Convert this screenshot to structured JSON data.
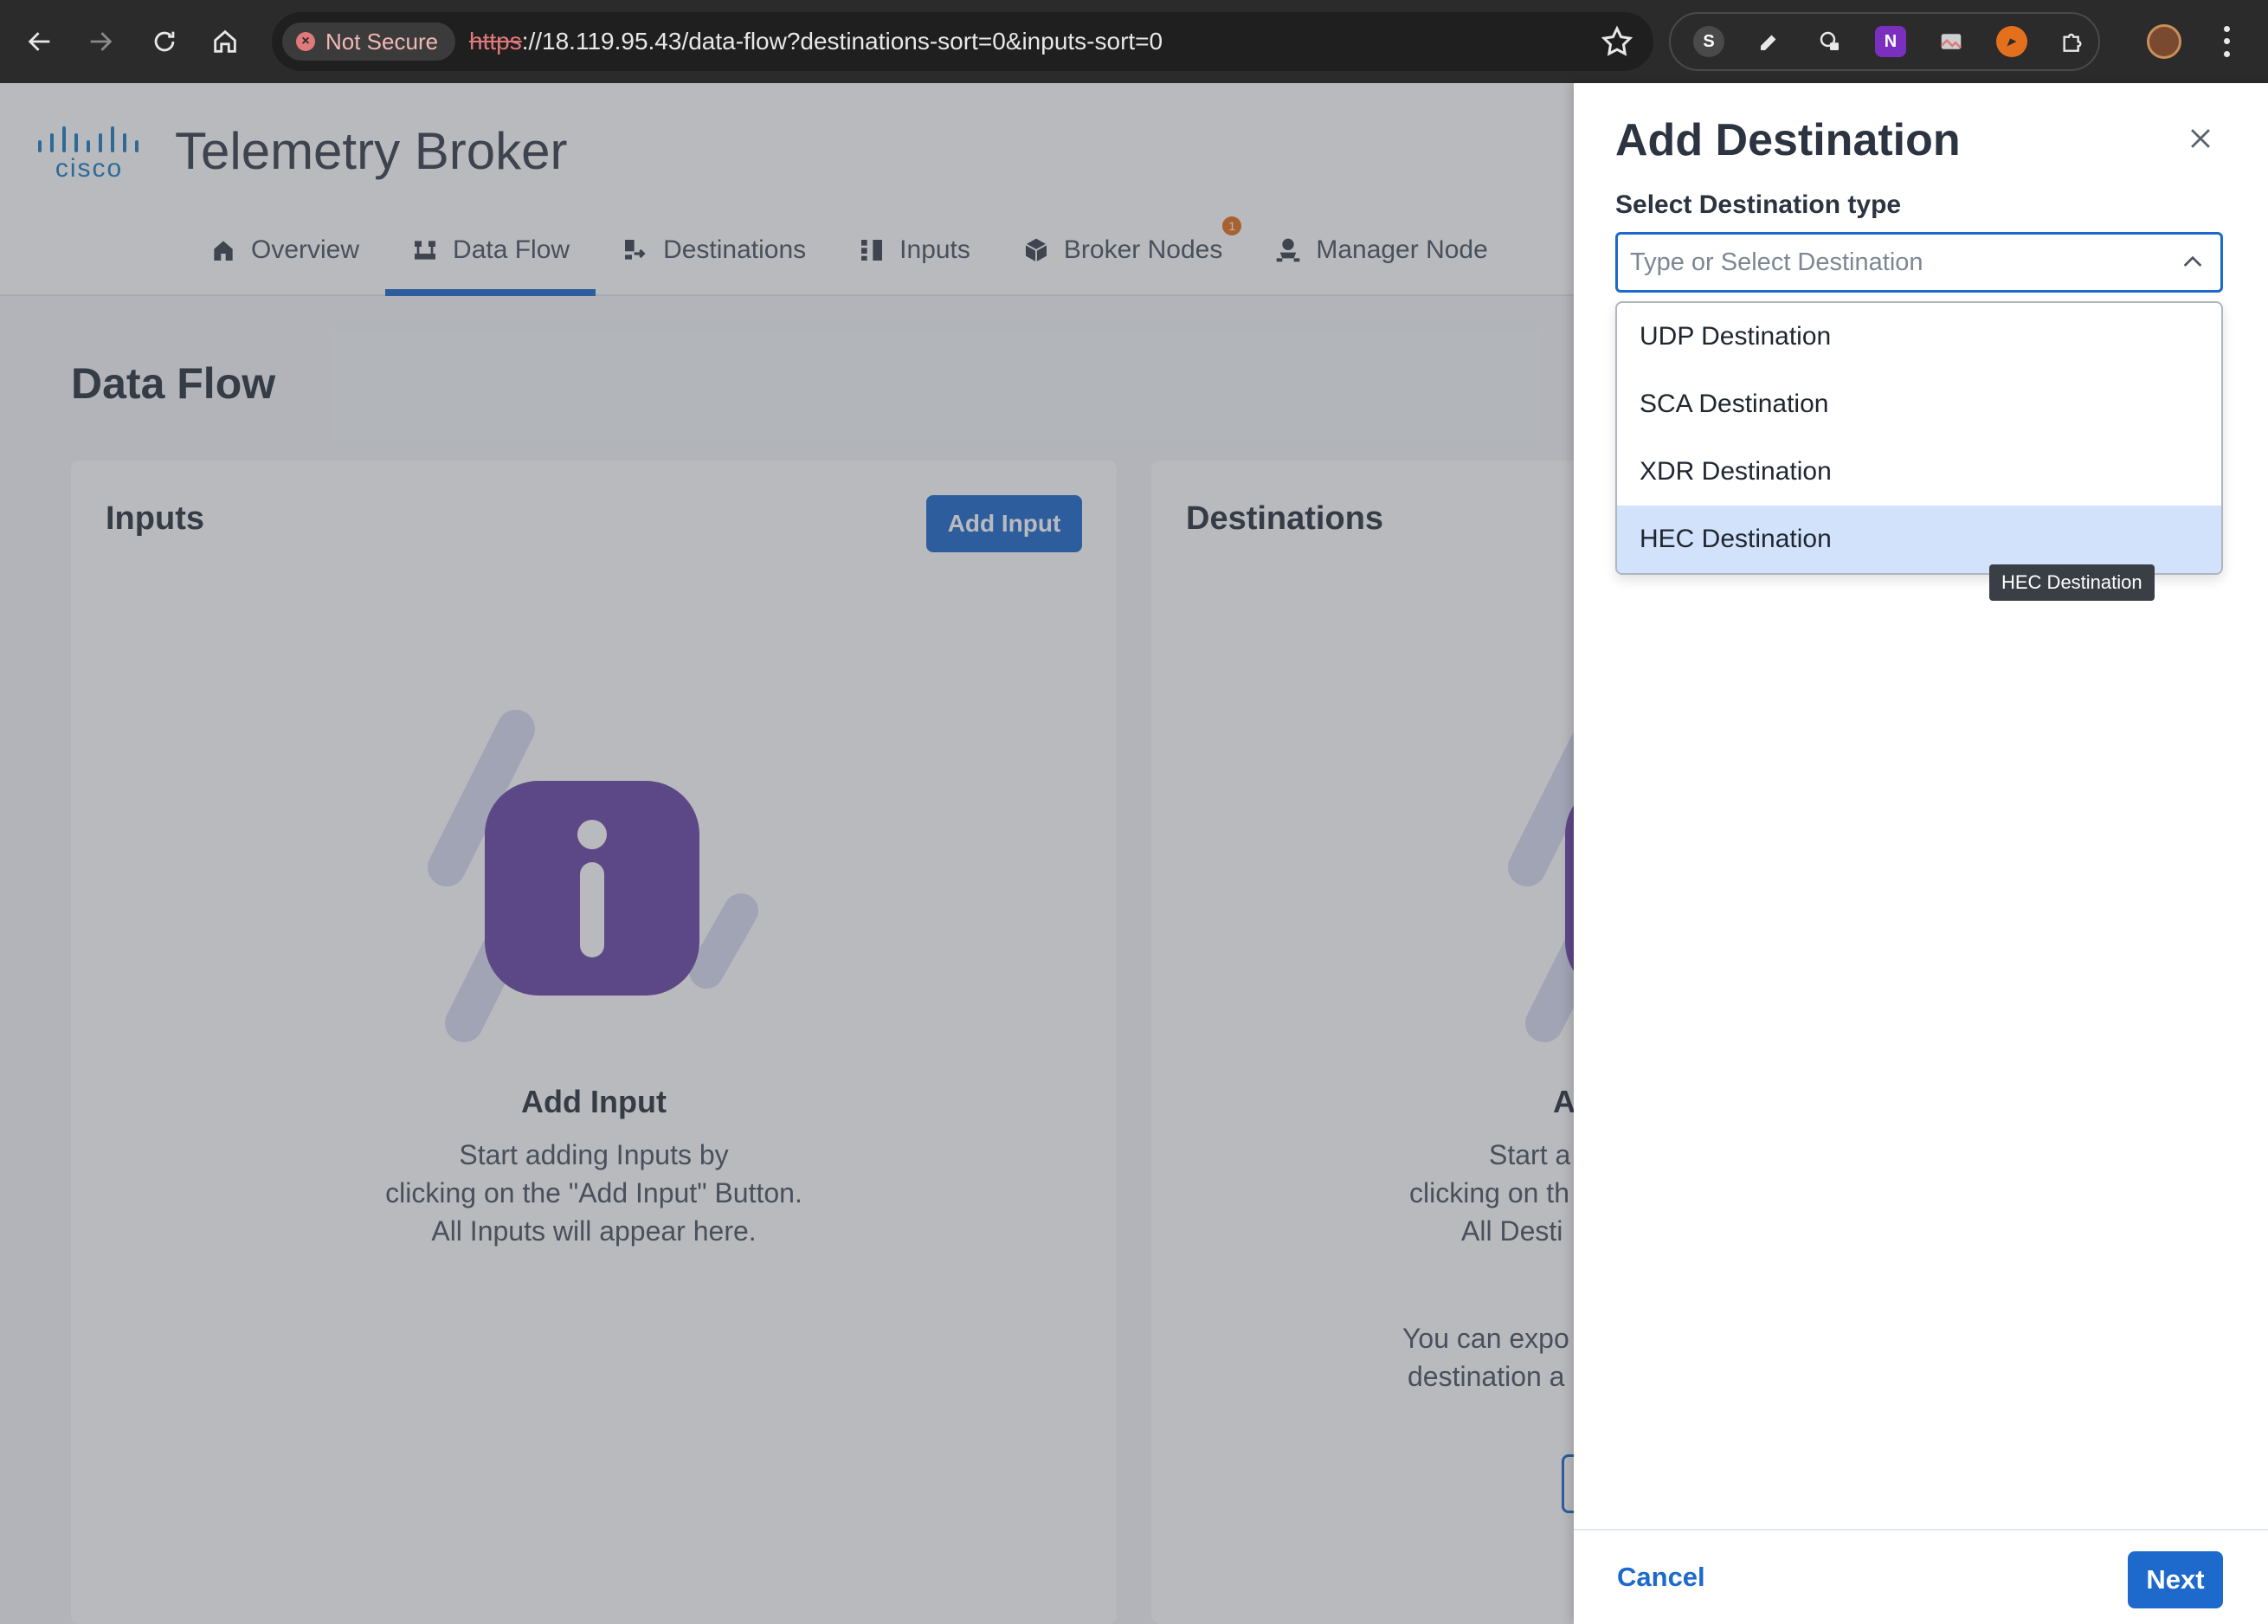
{
  "browser": {
    "security_label": "Not Secure",
    "url_scheme": "https",
    "url_rest": "://18.119.95.43/data-flow?destinations-sort=0&inputs-sort=0",
    "extensions": [
      "skype-icon",
      "pen-icon",
      "lock-icon",
      "onenote-icon",
      "image-icon",
      "pen-tool-icon",
      "puzzle-icon"
    ]
  },
  "app": {
    "brand": "cisco",
    "title": "Telemetry Broker",
    "tabs": [
      {
        "label": "Overview",
        "icon": "home-icon",
        "active": false
      },
      {
        "label": "Data Flow",
        "icon": "data-flow-icon",
        "active": true
      },
      {
        "label": "Destinations",
        "icon": "destinations-icon",
        "active": false
      },
      {
        "label": "Inputs",
        "icon": "inputs-icon",
        "active": false
      },
      {
        "label": "Broker Nodes",
        "icon": "cube-icon",
        "active": false,
        "badge": "1"
      },
      {
        "label": "Manager Node",
        "icon": "manager-icon",
        "active": false
      }
    ]
  },
  "page": {
    "title": "Data Flow",
    "inputs_card": {
      "title": "Inputs",
      "add_button": "Add Input",
      "empty_heading": "Add Input",
      "empty_lines": [
        "Start adding Inputs by",
        "clicking on the \"Add Input\" Button.",
        "All Inputs will appear here."
      ]
    },
    "destinations_card": {
      "title": "Destinations",
      "empty_heading": "A",
      "empty_lines": [
        "Start a",
        "clicking on th",
        "All Desti"
      ],
      "extra_lines": [
        "You can expo",
        "destination a"
      ]
    }
  },
  "drawer": {
    "title": "Add Destination",
    "field_label": "Select Destination type",
    "select_placeholder": "Type or Select Destination",
    "options": [
      "UDP Destination",
      "SCA Destination",
      "XDR Destination",
      "HEC Destination"
    ],
    "hovered_option": "HEC Destination",
    "tooltip": "HEC Destination",
    "cancel_label": "Cancel",
    "next_label": "Next"
  },
  "colors": {
    "accent": "#1d69cc",
    "illustration": "#6b48a8",
    "option_hover": "#d3e2fb",
    "not_secure": "#e0797a"
  }
}
